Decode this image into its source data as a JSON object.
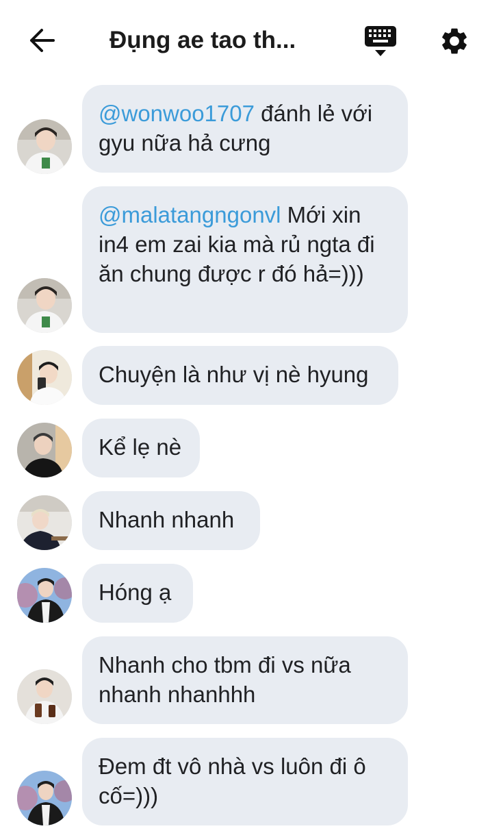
{
  "header": {
    "title": "Đụng ae tao th...",
    "back_icon": "arrow-left-icon",
    "keyboard_icon": "keyboard-icon",
    "settings_icon": "gear-icon"
  },
  "colors": {
    "bubble": "#e8ecf2",
    "mention": "#3b9bd9",
    "text": "#202124",
    "icon": "#111111"
  },
  "messages": [
    {
      "mention": "@wonwoo1707",
      "text": " đánh lẻ với gyu nữa hả cưng"
    },
    {
      "mention": "@malatangngonvl",
      "text": " Mới xin in4 em zai kia mà rủ ngta đi ăn chung được r đó hả=)))"
    },
    {
      "mention": "",
      "text": "Chuyện là như vị nè hyung"
    },
    {
      "mention": "",
      "text": "Kể lẹ nè"
    },
    {
      "mention": "",
      "text": "Nhanh nhanh"
    },
    {
      "mention": "",
      "text": "Hóng ạ"
    },
    {
      "mention": "",
      "text": "Nhanh cho tbm đi vs nữa nhanh nhanhhh"
    },
    {
      "mention": "",
      "text": "Đem đt vô nhà vs luôn đi ô cố=)))"
    }
  ]
}
